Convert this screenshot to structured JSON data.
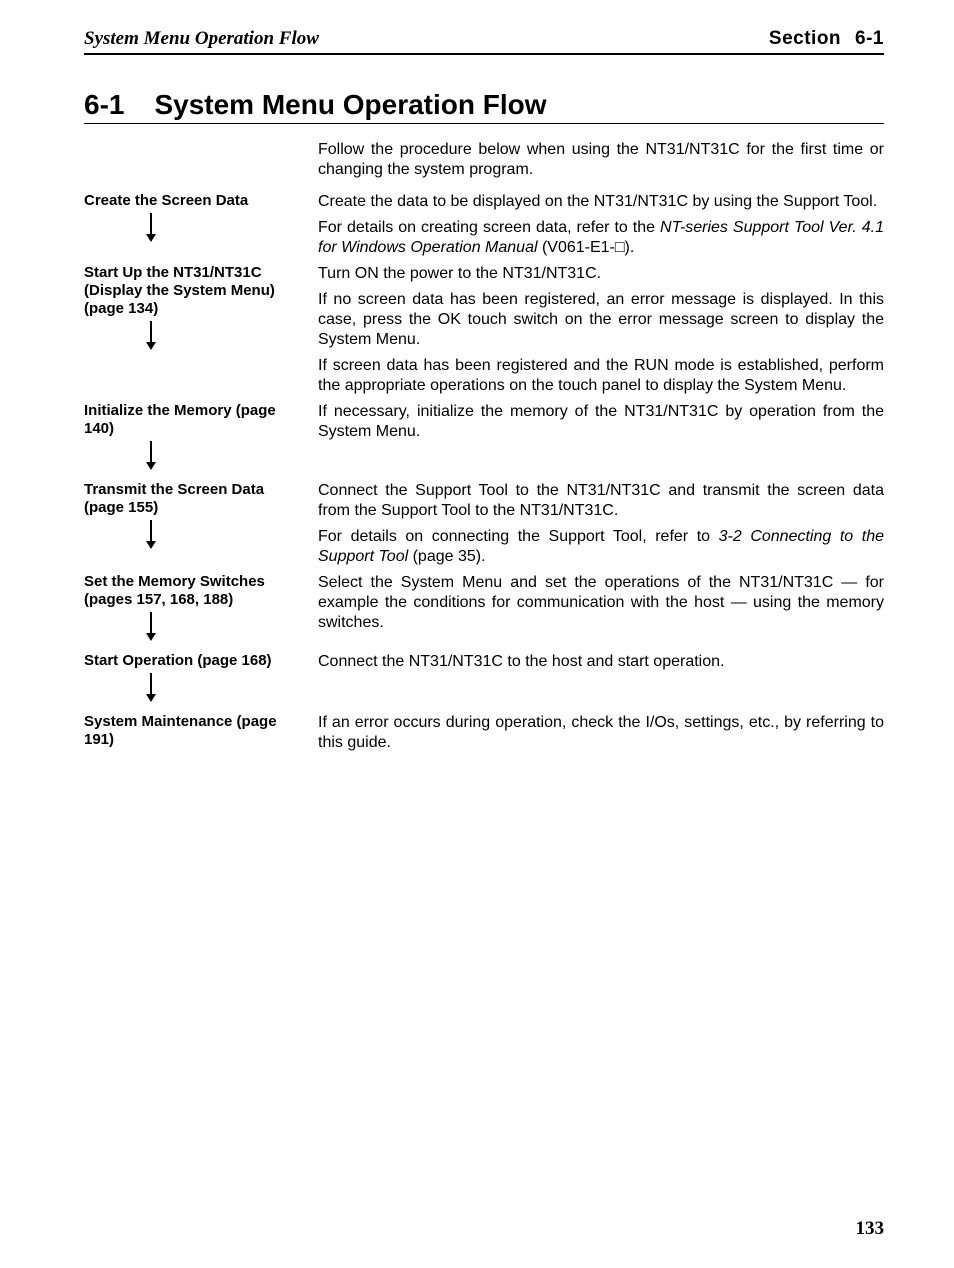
{
  "header": {
    "left": "System Menu Operation Flow",
    "right_label": "Section",
    "right_num": "6-1"
  },
  "title": {
    "num": "6-1",
    "text": "System Menu Operation Flow"
  },
  "intro": "Follow the procedure below when using the NT31/NT31C for the first time or changing the system program.",
  "steps": [
    {
      "label": "Create the Screen Data",
      "paras": [
        {
          "spans": [
            {
              "t": "Create the data to be displayed on the NT31/NT31C by using the Support Tool."
            }
          ]
        },
        {
          "spans": [
            {
              "t": "For details on creating screen data, refer to the "
            },
            {
              "t": "NT-series Support Tool Ver. 4.1 for Windows Operation Manual",
              "i": true
            },
            {
              "t": " (V061-E1-□)."
            }
          ]
        }
      ],
      "arrow": true
    },
    {
      "label": "Start Up the NT31/NT31C (Display the System Menu) (page 134)",
      "paras": [
        {
          "spans": [
            {
              "t": "Turn ON the power to the NT31/NT31C."
            }
          ]
        },
        {
          "spans": [
            {
              "t": "If no screen data has been registered, an error message is displayed. In this case, press the OK touch switch on the error message screen to display the System Menu."
            }
          ]
        },
        {
          "spans": [
            {
              "t": "If screen data has been registered and the RUN mode is established, perform the appropriate operations on the touch panel to display the System Menu."
            }
          ]
        }
      ],
      "arrow": true
    },
    {
      "label": "Initialize the Memory (page 140)",
      "paras": [
        {
          "spans": [
            {
              "t": "If necessary, initialize the memory of the NT31/NT31C by operation from the System Menu."
            }
          ]
        }
      ],
      "arrow": true
    },
    {
      "label": "Transmit the Screen Data (page 155)",
      "paras": [
        {
          "spans": [
            {
              "t": "Connect the Support Tool to the NT31/NT31C and transmit the screen data from the Support Tool to the NT31/NT31C."
            }
          ]
        },
        {
          "spans": [
            {
              "t": "For details on connecting the Support Tool, refer to "
            },
            {
              "t": "3-2 Connecting to the Support Tool",
              "i": true
            },
            {
              "t": " (page 35)."
            }
          ]
        }
      ],
      "arrow": true
    },
    {
      "label": "Set the Memory Switches (pages 157, 168, 188)",
      "paras": [
        {
          "spans": [
            {
              "t": "Select the System Menu and set the operations of the NT31/NT31C — for example the conditions for communication with the host — using the memory switches."
            }
          ]
        }
      ],
      "arrow": true
    },
    {
      "label": "Start Operation (page 168)",
      "paras": [
        {
          "spans": [
            {
              "t": "Connect the NT31/NT31C to the host and start operation."
            }
          ]
        }
      ],
      "arrow": true
    },
    {
      "label": "System Maintenance (page 191)",
      "paras": [
        {
          "spans": [
            {
              "t": "If an error occurs during operation, check the I/Os, settings, etc., by referring to this guide."
            }
          ]
        }
      ],
      "arrow": false
    }
  ],
  "pagenum": "133"
}
